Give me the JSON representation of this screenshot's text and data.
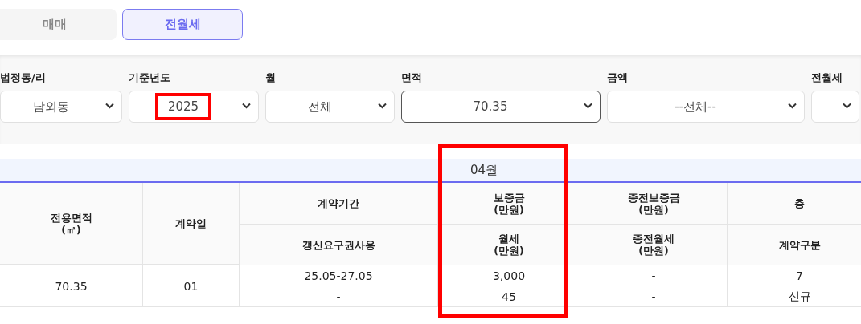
{
  "tabs": [
    {
      "label": "매매",
      "selected": false
    },
    {
      "label": "전월세",
      "selected": true
    }
  ],
  "filters": [
    {
      "label": "법정동/리",
      "value": "남외동",
      "focused": false
    },
    {
      "label": "기준년도",
      "value": "2025",
      "highlighted": true,
      "focused": false
    },
    {
      "label": "월",
      "value": "전체",
      "focused": false
    },
    {
      "label": "면적",
      "value": "70.35",
      "focused": true
    },
    {
      "label": "금액",
      "value": "--전체--",
      "focused": false
    },
    {
      "label": "전월세",
      "focused": false
    }
  ],
  "table": {
    "month_header": "04월",
    "columns": [
      {
        "label": "전용면적\n(㎡)"
      },
      {
        "label": "계약일"
      },
      {
        "label": "계약기간",
        "sub_label": "갱신요구권사용"
      },
      {
        "label": "보증금\n(만원)",
        "sub_label": "월세\n(만원)",
        "highlighted": true
      },
      {
        "label": "종전보증금\n(만원)",
        "sub_label": "종전월세\n(만원)"
      },
      {
        "label": "층",
        "sub_label": "계약구분"
      }
    ],
    "rows": [
      {
        "cells": [
          {
            "value": "70.35"
          },
          {
            "value": "01"
          },
          {
            "value": "25.05-27.05",
            "sub_value": "-"
          },
          {
            "value": "3,000",
            "sub_value": "45"
          },
          {
            "value": "-",
            "sub_value": "-"
          },
          {
            "value": "7",
            "sub_value": "신규"
          }
        ]
      }
    ]
  }
}
